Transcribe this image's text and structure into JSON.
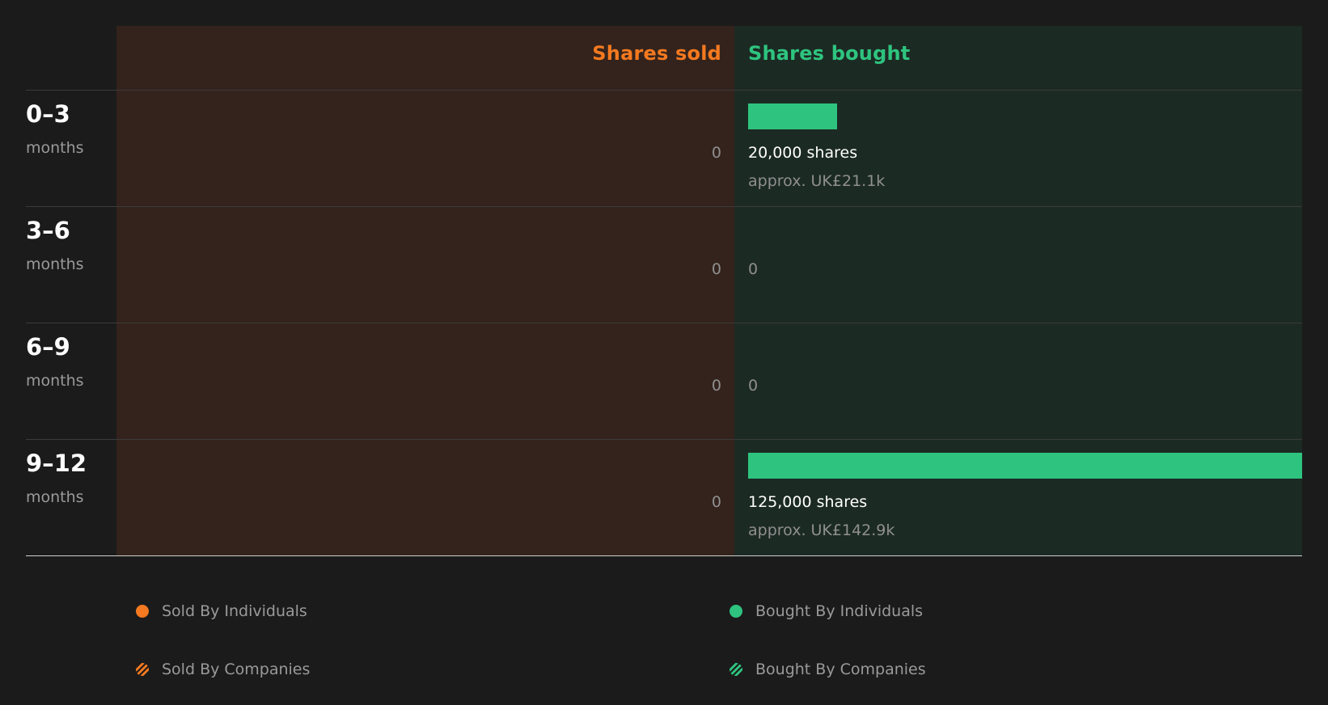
{
  "chart_data": {
    "type": "bar",
    "headers": {
      "sold": "Shares sold",
      "bought": "Shares bought"
    },
    "rows": [
      {
        "period": "0–3",
        "unit": "months",
        "sold_text": "0",
        "bought_shares": 20000,
        "bought_text": "20,000 shares",
        "bought_approx": "approx. UK£21.1k",
        "bought_zero_text": ""
      },
      {
        "period": "3–6",
        "unit": "months",
        "sold_text": "0",
        "bought_shares": 0,
        "bought_text": "",
        "bought_approx": "",
        "bought_zero_text": "0"
      },
      {
        "period": "6–9",
        "unit": "months",
        "sold_text": "0",
        "bought_shares": 0,
        "bought_text": "",
        "bought_approx": "",
        "bought_zero_text": "0"
      },
      {
        "period": "9–12",
        "unit": "months",
        "sold_text": "0",
        "bought_shares": 125000,
        "bought_text": "125,000 shares",
        "bought_approx": "approx. UK£142.9k",
        "bought_zero_text": ""
      }
    ],
    "legend": [
      {
        "label": "Sold By Individuals",
        "style": "solid",
        "color": "#f47920"
      },
      {
        "label": "Bought By Individuals",
        "style": "solid",
        "color": "#2ec47f"
      },
      {
        "label": "Sold By Companies",
        "style": "hatched",
        "color": "#f47920"
      },
      {
        "label": "Bought By Companies",
        "style": "hatched",
        "color": "#2ec47f"
      }
    ],
    "colors": {
      "sold": "#f47920",
      "bought": "#2ec47f",
      "sold_background": "#33231c",
      "bought_background": "#1c2a24",
      "page_background": "#1b1b1b"
    }
  }
}
